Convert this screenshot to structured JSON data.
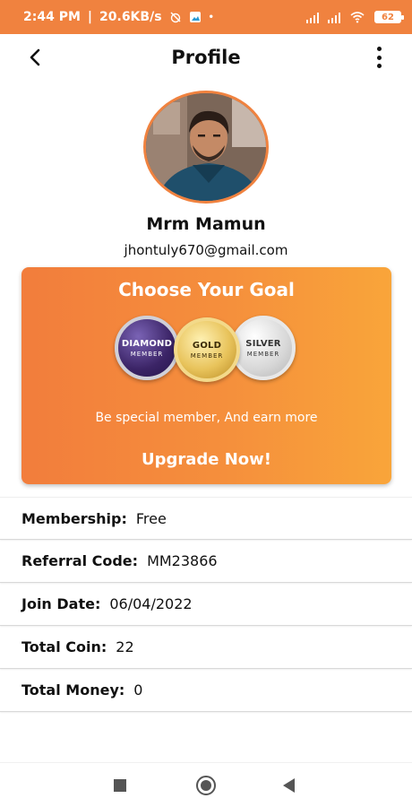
{
  "status": {
    "time": "2:44 PM",
    "speed": "20.6KB/s",
    "battery": "62"
  },
  "header": {
    "title": "Profile"
  },
  "profile": {
    "name": "Mrm Mamun",
    "email": "jhontuly670@gmail.com"
  },
  "promo": {
    "title": "Choose Your Goal",
    "medals": [
      {
        "top": "DIAMOND",
        "bottom": "MEMBER"
      },
      {
        "top": "GOLD",
        "bottom": "MEMBER"
      },
      {
        "top": "SILVER",
        "bottom": "MEMBER"
      }
    ],
    "subtitle": "Be special member, And earn more",
    "cta": "Upgrade Now!",
    "gradient_start": "#f27d3c",
    "gradient_end": "#f9a53a"
  },
  "info": [
    {
      "label": "Membership:",
      "value": "Free"
    },
    {
      "label": "Referral Code:",
      "value": "MM23866"
    },
    {
      "label": "Join Date:",
      "value": "06/04/2022"
    },
    {
      "label": "Total Coin:",
      "value": "22"
    },
    {
      "label": "Total Money:",
      "value": "0"
    }
  ],
  "colors": {
    "accent": "#f0823f"
  },
  "icons": [
    "back-arrow-icon",
    "more-vert-icon",
    "signal-icon",
    "wifi-icon",
    "battery-icon",
    "nav-recents-icon",
    "nav-home-icon",
    "nav-back-icon"
  ]
}
